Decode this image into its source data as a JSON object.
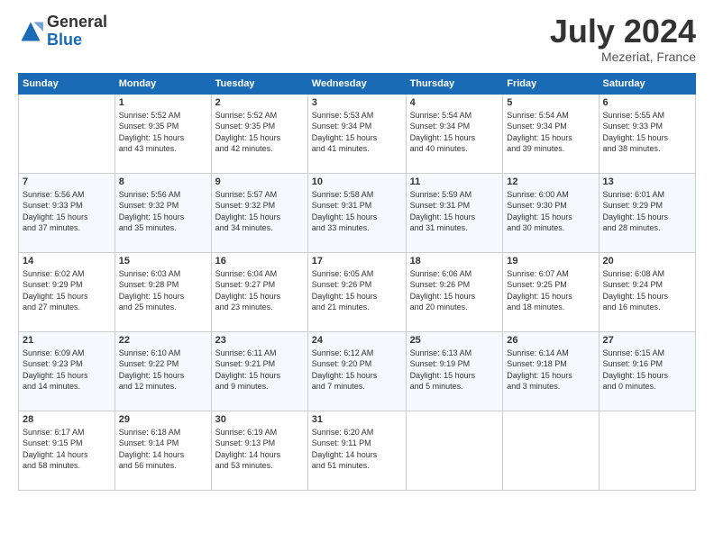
{
  "header": {
    "logo_general": "General",
    "logo_blue": "Blue",
    "month_year": "July 2024",
    "location": "Mezeriat, France"
  },
  "weekdays": [
    "Sunday",
    "Monday",
    "Tuesday",
    "Wednesday",
    "Thursday",
    "Friday",
    "Saturday"
  ],
  "weeks": [
    [
      {
        "day": "",
        "content": ""
      },
      {
        "day": "1",
        "content": "Sunrise: 5:52 AM\nSunset: 9:35 PM\nDaylight: 15 hours\nand 43 minutes."
      },
      {
        "day": "2",
        "content": "Sunrise: 5:52 AM\nSunset: 9:35 PM\nDaylight: 15 hours\nand 42 minutes."
      },
      {
        "day": "3",
        "content": "Sunrise: 5:53 AM\nSunset: 9:34 PM\nDaylight: 15 hours\nand 41 minutes."
      },
      {
        "day": "4",
        "content": "Sunrise: 5:54 AM\nSunset: 9:34 PM\nDaylight: 15 hours\nand 40 minutes."
      },
      {
        "day": "5",
        "content": "Sunrise: 5:54 AM\nSunset: 9:34 PM\nDaylight: 15 hours\nand 39 minutes."
      },
      {
        "day": "6",
        "content": "Sunrise: 5:55 AM\nSunset: 9:33 PM\nDaylight: 15 hours\nand 38 minutes."
      }
    ],
    [
      {
        "day": "7",
        "content": "Sunrise: 5:56 AM\nSunset: 9:33 PM\nDaylight: 15 hours\nand 37 minutes."
      },
      {
        "day": "8",
        "content": "Sunrise: 5:56 AM\nSunset: 9:32 PM\nDaylight: 15 hours\nand 35 minutes."
      },
      {
        "day": "9",
        "content": "Sunrise: 5:57 AM\nSunset: 9:32 PM\nDaylight: 15 hours\nand 34 minutes."
      },
      {
        "day": "10",
        "content": "Sunrise: 5:58 AM\nSunset: 9:31 PM\nDaylight: 15 hours\nand 33 minutes."
      },
      {
        "day": "11",
        "content": "Sunrise: 5:59 AM\nSunset: 9:31 PM\nDaylight: 15 hours\nand 31 minutes."
      },
      {
        "day": "12",
        "content": "Sunrise: 6:00 AM\nSunset: 9:30 PM\nDaylight: 15 hours\nand 30 minutes."
      },
      {
        "day": "13",
        "content": "Sunrise: 6:01 AM\nSunset: 9:29 PM\nDaylight: 15 hours\nand 28 minutes."
      }
    ],
    [
      {
        "day": "14",
        "content": "Sunrise: 6:02 AM\nSunset: 9:29 PM\nDaylight: 15 hours\nand 27 minutes."
      },
      {
        "day": "15",
        "content": "Sunrise: 6:03 AM\nSunset: 9:28 PM\nDaylight: 15 hours\nand 25 minutes."
      },
      {
        "day": "16",
        "content": "Sunrise: 6:04 AM\nSunset: 9:27 PM\nDaylight: 15 hours\nand 23 minutes."
      },
      {
        "day": "17",
        "content": "Sunrise: 6:05 AM\nSunset: 9:26 PM\nDaylight: 15 hours\nand 21 minutes."
      },
      {
        "day": "18",
        "content": "Sunrise: 6:06 AM\nSunset: 9:26 PM\nDaylight: 15 hours\nand 20 minutes."
      },
      {
        "day": "19",
        "content": "Sunrise: 6:07 AM\nSunset: 9:25 PM\nDaylight: 15 hours\nand 18 minutes."
      },
      {
        "day": "20",
        "content": "Sunrise: 6:08 AM\nSunset: 9:24 PM\nDaylight: 15 hours\nand 16 minutes."
      }
    ],
    [
      {
        "day": "21",
        "content": "Sunrise: 6:09 AM\nSunset: 9:23 PM\nDaylight: 15 hours\nand 14 minutes."
      },
      {
        "day": "22",
        "content": "Sunrise: 6:10 AM\nSunset: 9:22 PM\nDaylight: 15 hours\nand 12 minutes."
      },
      {
        "day": "23",
        "content": "Sunrise: 6:11 AM\nSunset: 9:21 PM\nDaylight: 15 hours\nand 9 minutes."
      },
      {
        "day": "24",
        "content": "Sunrise: 6:12 AM\nSunset: 9:20 PM\nDaylight: 15 hours\nand 7 minutes."
      },
      {
        "day": "25",
        "content": "Sunrise: 6:13 AM\nSunset: 9:19 PM\nDaylight: 15 hours\nand 5 minutes."
      },
      {
        "day": "26",
        "content": "Sunrise: 6:14 AM\nSunset: 9:18 PM\nDaylight: 15 hours\nand 3 minutes."
      },
      {
        "day": "27",
        "content": "Sunrise: 6:15 AM\nSunset: 9:16 PM\nDaylight: 15 hours\nand 0 minutes."
      }
    ],
    [
      {
        "day": "28",
        "content": "Sunrise: 6:17 AM\nSunset: 9:15 PM\nDaylight: 14 hours\nand 58 minutes."
      },
      {
        "day": "29",
        "content": "Sunrise: 6:18 AM\nSunset: 9:14 PM\nDaylight: 14 hours\nand 56 minutes."
      },
      {
        "day": "30",
        "content": "Sunrise: 6:19 AM\nSunset: 9:13 PM\nDaylight: 14 hours\nand 53 minutes."
      },
      {
        "day": "31",
        "content": "Sunrise: 6:20 AM\nSunset: 9:11 PM\nDaylight: 14 hours\nand 51 minutes."
      },
      {
        "day": "",
        "content": ""
      },
      {
        "day": "",
        "content": ""
      },
      {
        "day": "",
        "content": ""
      }
    ]
  ]
}
